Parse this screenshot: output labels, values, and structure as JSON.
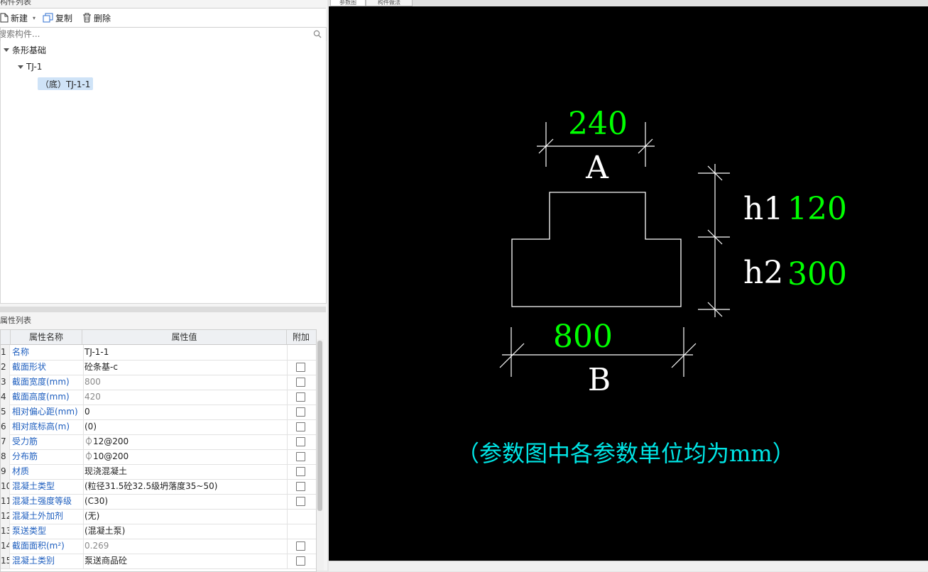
{
  "left_panel": {
    "component_list_title": "构件列表",
    "toolbar": {
      "new_label": "新建",
      "copy_label": "复制",
      "delete_label": "删除"
    },
    "search": {
      "placeholder": "搜索构件..."
    },
    "tree": {
      "root": "条形基础",
      "child": "TJ-1",
      "leaf": "（底）TJ-1-1"
    },
    "property_list_title": "属性列表",
    "property_table": {
      "headers": [
        "属性名称",
        "属性值",
        "附加"
      ],
      "rows": [
        {
          "num": "1",
          "name": "名称",
          "value": "TJ-1-1",
          "gray": false,
          "checkbox": false
        },
        {
          "num": "2",
          "name": "截面形状",
          "value": "砼条基-c",
          "gray": false,
          "checkbox": true
        },
        {
          "num": "3",
          "name": "截面宽度(mm)",
          "value": "800",
          "gray": true,
          "checkbox": true
        },
        {
          "num": "4",
          "name": "截面高度(mm)",
          "value": "420",
          "gray": true,
          "checkbox": true
        },
        {
          "num": "5",
          "name": "相对偏心距(mm)",
          "value": "0",
          "gray": false,
          "checkbox": true
        },
        {
          "num": "6",
          "name": "相对底标高(m)",
          "value": "(0)",
          "gray": false,
          "checkbox": true
        },
        {
          "num": "7",
          "name": "受力筋",
          "value": "⏀12@200",
          "gray": false,
          "checkbox": true
        },
        {
          "num": "8",
          "name": "分布筋",
          "value": "⏀10@200",
          "gray": false,
          "checkbox": true
        },
        {
          "num": "9",
          "name": "材质",
          "value": "现浇混凝土",
          "gray": false,
          "checkbox": true
        },
        {
          "num": "10",
          "name": "混凝土类型",
          "value": "(粒径31.5砼32.5级坍落度35~50)",
          "gray": false,
          "checkbox": true
        },
        {
          "num": "11",
          "name": "混凝土强度等级",
          "value": "(C30)",
          "gray": false,
          "checkbox": true
        },
        {
          "num": "12",
          "name": "混凝土外加剂",
          "value": "(无)",
          "gray": false,
          "checkbox": false
        },
        {
          "num": "13",
          "name": "泵送类型",
          "value": "(混凝土泵)",
          "gray": false,
          "checkbox": false
        },
        {
          "num": "14",
          "name": "截面面积(m²)",
          "value": "0.269",
          "gray": true,
          "checkbox": true
        },
        {
          "num": "15",
          "name": "混凝土类别",
          "value": "泵送商品砼",
          "gray": false,
          "checkbox": true
        }
      ]
    }
  },
  "tabs": [
    {
      "label": "参数图",
      "active": true
    },
    {
      "label": "构件做法",
      "active": false
    }
  ],
  "diagram": {
    "top_width_value": "240",
    "top_width_label": "A",
    "h1_label": "h1",
    "h1_value": "120",
    "h2_label": "h2",
    "h2_value": "300",
    "bottom_width_value": "800",
    "bottom_width_label": "B",
    "note": "（参数图中各参数单位均为mm）",
    "colors": {
      "background": "#000000",
      "lines": "#ffffff",
      "values": "#00ff00",
      "note": "#00e5e5"
    }
  }
}
